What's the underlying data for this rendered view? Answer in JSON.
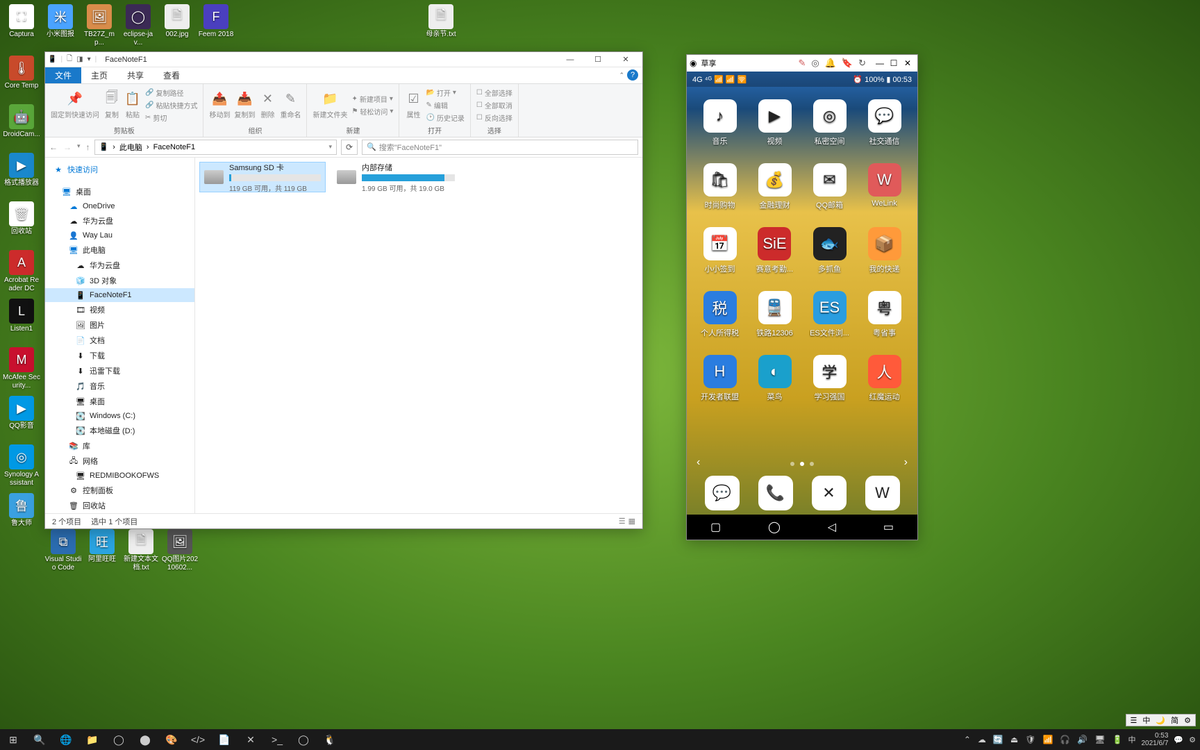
{
  "desktop_top": [
    {
      "label": "Captura",
      "bg": "#ffffff",
      "glyph": "⛶"
    },
    {
      "label": "小米图报",
      "bg": "#4aa3ff",
      "glyph": "米"
    },
    {
      "label": "TB27Z_mp...",
      "bg": "#d88c4a",
      "glyph": "🖼"
    },
    {
      "label": "eclipse-jav...",
      "bg": "#3b2a55",
      "glyph": "◯"
    },
    {
      "label": "002.jpg",
      "bg": "#eeeeee",
      "glyph": "🗎"
    },
    {
      "label": "Feem 2018",
      "bg": "#4a3fbf",
      "glyph": "F"
    }
  ],
  "desktop_top_lone": {
    "label": "母亲节.txt",
    "bg": "#eeeeee",
    "glyph": "🗎"
  },
  "desktop_left": [
    {
      "label": "Core Temp",
      "bg": "#c84a2a",
      "glyph": "🌡"
    },
    {
      "label": "DroidCam...",
      "bg": "#5aa73a",
      "glyph": "🤖"
    },
    {
      "label": "格式播放器",
      "bg": "#1a88cc",
      "glyph": "▶"
    },
    {
      "label": "回收站",
      "bg": "#ffffff",
      "glyph": "🗑"
    },
    {
      "label": "Acrobat Reader DC",
      "bg": "#cc2b2b",
      "glyph": "A"
    },
    {
      "label": "Listen1",
      "bg": "#111111",
      "glyph": "L"
    },
    {
      "label": "McAfee Security...",
      "bg": "#c8102e",
      "glyph": "M"
    },
    {
      "label": "QQ影音",
      "bg": "#0099e5",
      "glyph": "▶"
    },
    {
      "label": "Synology Assistant",
      "bg": "#0099e5",
      "glyph": "◎"
    },
    {
      "label": "鲁大师",
      "bg": "#3aa0e0",
      "glyph": "鲁"
    }
  ],
  "desktop_bottom": [
    {
      "label": "Visual Studio Code",
      "bg": "#2b6cb0",
      "glyph": "⧉"
    },
    {
      "label": "阿里旺旺",
      "bg": "#2aa3e0",
      "glyph": "旺"
    },
    {
      "label": "新建文本文档.txt",
      "bg": "#eeeeee",
      "glyph": "🗎"
    },
    {
      "label": "QQ图片20210602...",
      "bg": "#555555",
      "glyph": "🖼"
    }
  ],
  "explorer": {
    "title": "FaceNoteF1",
    "tabs": [
      "文件",
      "主页",
      "共享",
      "查看"
    ],
    "ribbon": {
      "pin": "固定到快速访问",
      "copy": "复制",
      "paste": "粘贴",
      "copy_path": "复制路径",
      "paste_shortcut": "粘贴快捷方式",
      "cut": "剪切",
      "clipboard": "剪贴板",
      "move_to": "移动到",
      "copy_to": "复制到",
      "delete": "删除",
      "rename": "重命名",
      "organize": "组织",
      "new_folder": "新建文件夹",
      "new_item": "新建项目",
      "easy_access": "轻松访问",
      "new_group": "新建",
      "properties": "属性",
      "open": "打开",
      "edit": "编辑",
      "history": "历史记录",
      "open_group": "打开",
      "select_all": "全部选择",
      "select_none": "全部取消",
      "invert": "反向选择",
      "select": "选择"
    },
    "breadcrumb": [
      "此电脑",
      "FaceNoteF1"
    ],
    "search_placeholder": "搜索\"FaceNoteF1\"",
    "nav_pane": {
      "quick_access": "快速访问",
      "desktop": "桌面",
      "onedrive": "OneDrive",
      "huawei_cloud": "华为云盘",
      "way_lau": "Way Lau",
      "this_pc": "此电脑",
      "this_pc_children": [
        {
          "label": "华为云盘",
          "glyph": "☁"
        },
        {
          "label": "3D 对象",
          "glyph": "🧊"
        },
        {
          "label": "FaceNoteF1",
          "glyph": "📱",
          "selected": true
        },
        {
          "label": "视频",
          "glyph": "🎞"
        },
        {
          "label": "图片",
          "glyph": "🖼"
        },
        {
          "label": "文档",
          "glyph": "📄"
        },
        {
          "label": "下载",
          "glyph": "⬇"
        },
        {
          "label": "迅雷下载",
          "glyph": "⬇"
        },
        {
          "label": "音乐",
          "glyph": "🎵"
        },
        {
          "label": "桌面",
          "glyph": "🖥"
        },
        {
          "label": "Windows (C:)",
          "glyph": "💽"
        },
        {
          "label": "本地磁盘 (D:)",
          "glyph": "💽"
        }
      ],
      "libraries": "库",
      "network": "网络",
      "redmibook": "REDMIBOOKOFWS",
      "control_panel": "控制面板",
      "recycle": "回收站"
    },
    "drives": [
      {
        "name": "Samsung SD 卡",
        "sub": "119 GB 可用，共 119 GB",
        "fill": 2,
        "selected": true
      },
      {
        "name": "内部存储",
        "sub": "1.99 GB 可用，共 19.0 GB",
        "fill": 89,
        "selected": false
      }
    ],
    "status": {
      "count": "2 个项目",
      "selected": "选中 1 个项目"
    }
  },
  "phone": {
    "title": "草享",
    "status_left": "4G ⁴ᴳ 📶 📶 🛜",
    "status_right": "⏰ 100% ▮ 00:53",
    "apps": [
      {
        "label": "音乐",
        "glyph": "♪"
      },
      {
        "label": "视频",
        "glyph": "▶"
      },
      {
        "label": "私密空间",
        "glyph": "◎"
      },
      {
        "label": "社交通信",
        "glyph": "💬"
      },
      {
        "label": "时尚购物",
        "glyph": "🛍"
      },
      {
        "label": "金融理财",
        "glyph": "💰"
      },
      {
        "label": "QQ邮箱",
        "glyph": "✉"
      },
      {
        "label": "WeLink",
        "glyph": "W",
        "bg": "#e05a5a"
      },
      {
        "label": "小小签到",
        "glyph": "📅"
      },
      {
        "label": "赛意考勤...",
        "glyph": "SiE",
        "bg": "#cc2b2b"
      },
      {
        "label": "多抓鱼",
        "glyph": "🐟",
        "bg": "#222"
      },
      {
        "label": "我的快递",
        "glyph": "📦",
        "bg": "#ff9a3a"
      },
      {
        "label": "个人所得税",
        "glyph": "税",
        "bg": "#2a7de0"
      },
      {
        "label": "铁路12306",
        "glyph": "🚆"
      },
      {
        "label": "ES文件浏...",
        "glyph": "ES",
        "bg": "#2a9de0"
      },
      {
        "label": "粤省事",
        "glyph": "粤"
      },
      {
        "label": "开发者联盟",
        "glyph": "H",
        "bg": "#2a7de0"
      },
      {
        "label": "菜鸟",
        "glyph": "◐",
        "bg": "#1aa0cc"
      },
      {
        "label": "学习强国",
        "glyph": "学"
      },
      {
        "label": "红魔运动",
        "glyph": "人",
        "bg": "#ff5a3a"
      }
    ],
    "dock": [
      {
        "glyph": "💬"
      },
      {
        "glyph": "📞"
      },
      {
        "glyph": "✕"
      },
      {
        "glyph": "W"
      }
    ]
  },
  "taskbar": {
    "buttons": [
      "⊞",
      "🔍",
      "🌐",
      "📁",
      "◯",
      "⬤",
      "🎨",
      "</>",
      "📄",
      "✕",
      ">_",
      "◯",
      "🐧"
    ],
    "tray_icons": [
      "⌃",
      "☁",
      "🔄",
      "⏏",
      "🛡",
      "📶",
      "🎧",
      "🔊",
      "🖥",
      "🔋"
    ],
    "ime": "中",
    "time": "0:53",
    "date": "2021/6/7"
  },
  "ime_float": [
    "☰",
    "中",
    "🌙",
    "简",
    "⚙"
  ]
}
